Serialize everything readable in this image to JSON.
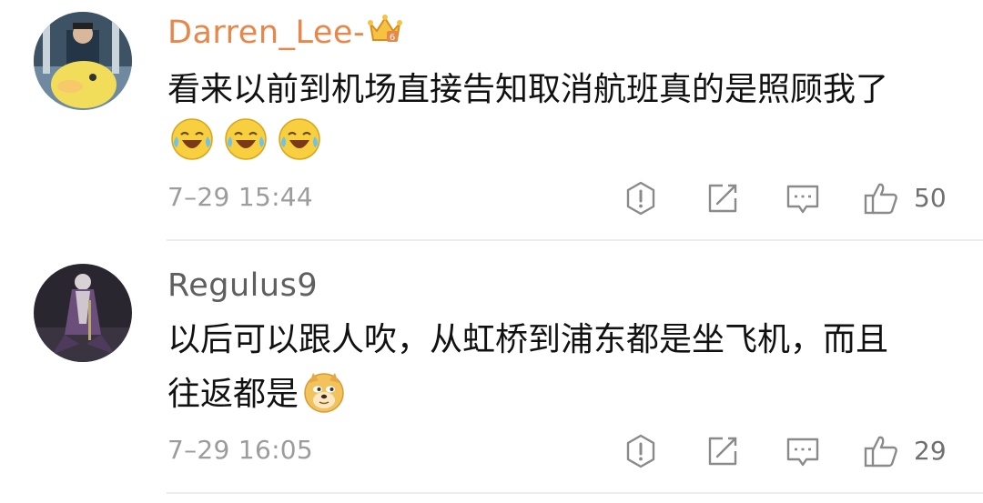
{
  "comments": [
    {
      "username": "Darren_Lee-",
      "username_color": "#e8874a",
      "badge": "crown-vip-icon",
      "text_lines": [
        "看来以前到机场直接告知取消航班真的是照顾我了"
      ],
      "emojis": [
        "laughing-crying-emoji",
        "laughing-crying-emoji",
        "laughing-crying-emoji"
      ],
      "time": "7–29 15:44",
      "likes": "50"
    },
    {
      "username": "Regulus9",
      "username_color": "#5f5f5f",
      "text_lines": [
        "以后可以跟人吹，从虹桥到浦东都是坐飞机，而且",
        "往返都是"
      ],
      "emojis": [
        "doge-emoji"
      ],
      "time": "7–29 16:05",
      "likes": "29"
    }
  ],
  "actions": {
    "report": "report-icon",
    "repost": "repost-icon",
    "reply": "reply-icon",
    "like": "thumbs-up-icon"
  }
}
